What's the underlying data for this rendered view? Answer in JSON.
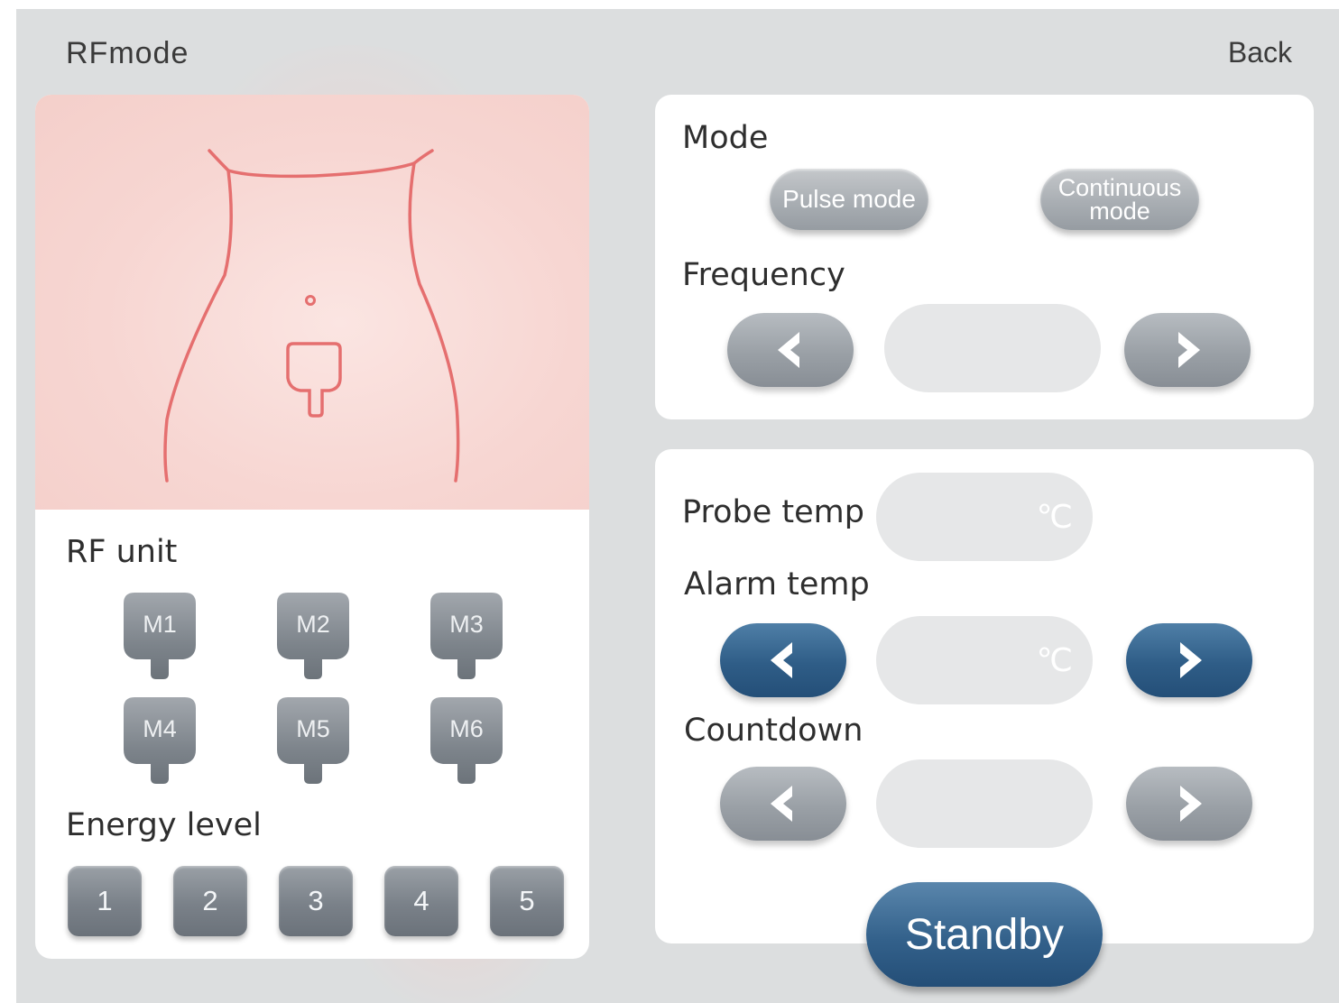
{
  "header": {
    "title": "RFmode",
    "back_label": "Back"
  },
  "left_panel": {
    "rf_unit_label": "RF unit",
    "units": [
      "M1",
      "M2",
      "M3",
      "M4",
      "M5",
      "M6"
    ],
    "energy_label": "Energy level",
    "levels": [
      "1",
      "2",
      "3",
      "4",
      "5"
    ]
  },
  "mode_panel": {
    "mode_label": "Mode",
    "pulse_label": "Pulse mode",
    "continuous_label": "Continuous mode",
    "frequency_label": "Frequency",
    "frequency_value": ""
  },
  "temp_panel": {
    "probe_label": "Probe temp",
    "probe_unit": "℃",
    "alarm_label": "Alarm temp",
    "alarm_unit": "℃",
    "countdown_label": "Countdown"
  },
  "standby_label": "Standby",
  "colors": {
    "accent_blue": "#2f5d87",
    "button_gray": "#9aa0a6",
    "outline_red": "#e56f6f"
  },
  "icons": {
    "left": "chevron-left-icon",
    "right": "chevron-right-icon",
    "probe": "probe-outline-icon"
  }
}
